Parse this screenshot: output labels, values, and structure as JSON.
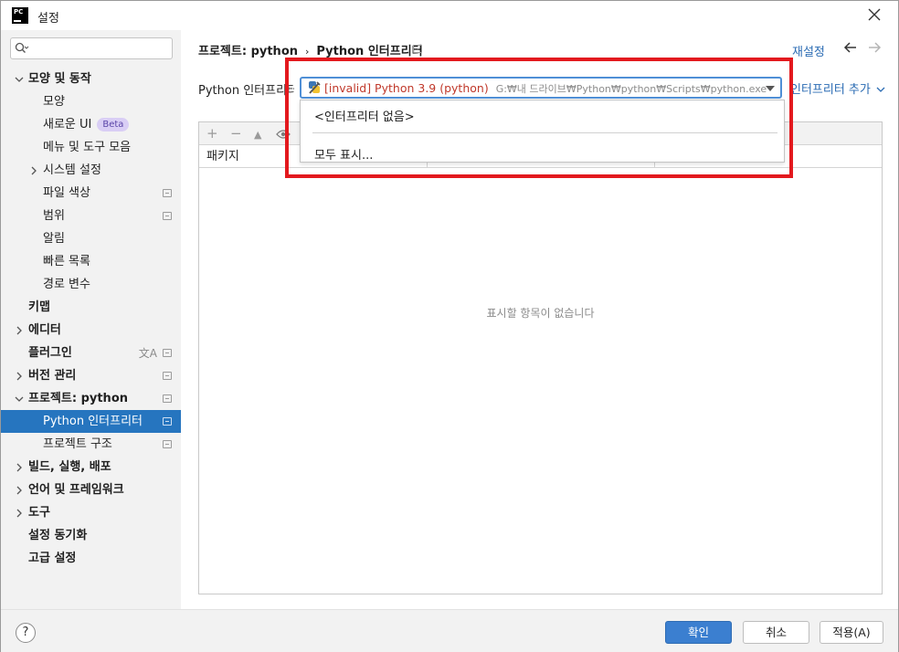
{
  "window": {
    "title": "설정",
    "logo_text": "PC"
  },
  "search": {
    "placeholder": ""
  },
  "sidebar": {
    "items": [
      {
        "label": "모양 및 동작",
        "bold": true
      },
      {
        "label": "모양"
      },
      {
        "label": "새로운 UI",
        "badge": "Beta"
      },
      {
        "label": "메뉴 및 도구 모음"
      },
      {
        "label": "시스템 설정"
      },
      {
        "label": "파일 색상"
      },
      {
        "label": "범위"
      },
      {
        "label": "알림"
      },
      {
        "label": "빠른 목록"
      },
      {
        "label": "경로 변수"
      },
      {
        "label": "키맵",
        "bold": true
      },
      {
        "label": "에디터",
        "bold": true
      },
      {
        "label": "플러그인",
        "bold": true
      },
      {
        "label": "버전 관리",
        "bold": true
      },
      {
        "label": "프로젝트: python",
        "bold": true
      },
      {
        "label": "Python 인터프리터",
        "selected": true
      },
      {
        "label": "프로젝트 구조"
      },
      {
        "label": "빌드, 실행, 배포",
        "bold": true
      },
      {
        "label": "언어 및 프레임워크",
        "bold": true
      },
      {
        "label": "도구",
        "bold": true
      },
      {
        "label": "설정 동기화",
        "bold": true
      },
      {
        "label": "고급 설정",
        "bold": true
      }
    ]
  },
  "breadcrumb": {
    "project": "프로젝트: python",
    "sep": "›",
    "page": "Python 인터프리터"
  },
  "header": {
    "reset": "재설정",
    "back_icon": "arrow-left-icon",
    "forward_icon": "arrow-right-icon"
  },
  "interpreter": {
    "label": "Python 인터프리터:",
    "invalid": "[invalid] Python 3.9 (python)",
    "path": "G:₩내 드라이브₩Python₩python₩Scripts₩python.exe",
    "add_label": "인터프리터 추가"
  },
  "dropdown": {
    "option_none": "<인터프리터 없음>",
    "show_all": "모두 표시..."
  },
  "packages": {
    "column_package": "패키지",
    "empty_text": "표시할 항목이 없습니다",
    "tools": {
      "add": "+",
      "remove": "−",
      "up": "▲"
    }
  },
  "footer": {
    "help": "?",
    "ok": "확인",
    "cancel": "취소",
    "apply": "적용(A)"
  },
  "colors": {
    "accent": "#2675bf",
    "highlight": "#e3191e",
    "invalid": "#c0392b",
    "link": "#2a6bb3"
  }
}
